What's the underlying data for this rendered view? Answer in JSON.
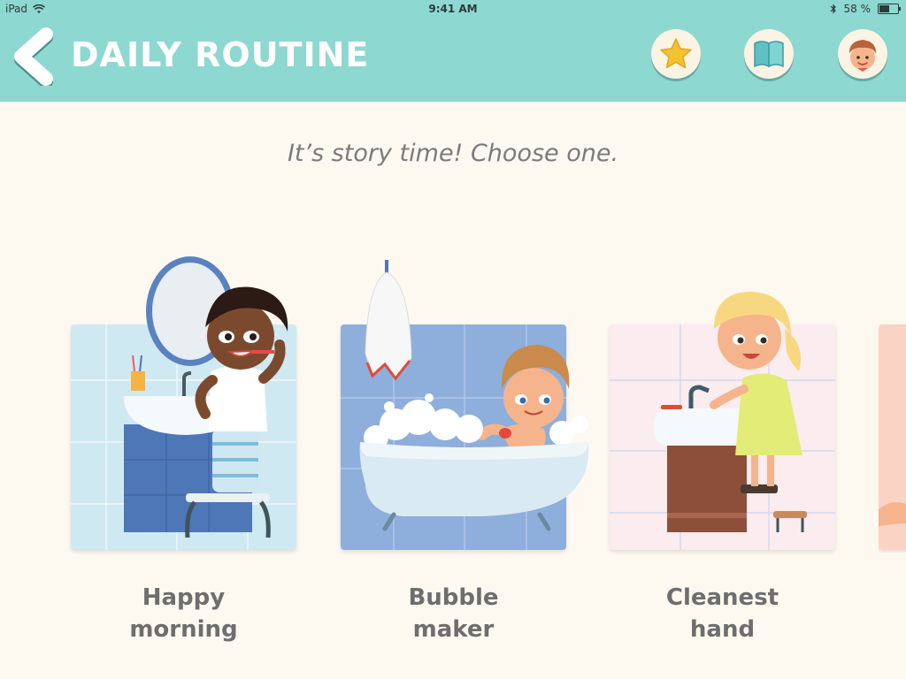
{
  "status": {
    "device": "iPad",
    "time": "9:41 AM",
    "battery": "58 %"
  },
  "header": {
    "title": "DAILY ROUTINE"
  },
  "prompt": "It’s story time! Choose one.",
  "stories": [
    {
      "title_line1": "Happy",
      "title_line2": "morning"
    },
    {
      "title_line1": "Bubble",
      "title_line2": "maker"
    },
    {
      "title_line1": "Cleanest",
      "title_line2": "hand"
    }
  ],
  "colors": {
    "header_bg": "#8dd8d1",
    "page_bg": "#fdf9f1",
    "label_text": "#6e6e6e"
  }
}
